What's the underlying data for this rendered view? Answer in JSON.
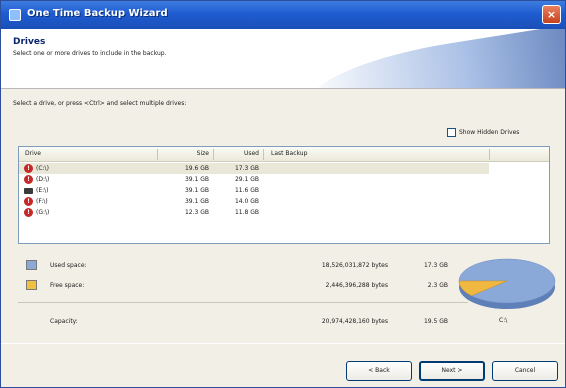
{
  "window": {
    "title": "One Time Backup Wizard",
    "close_glyph": "×"
  },
  "header": {
    "title": "Drives",
    "subtitle": "Select one or more drives to include in the backup."
  },
  "instruction": "Select a drive, or press <Ctrl> and select multiple drives:",
  "show_hidden": {
    "label": "Show Hidden Drives",
    "checked": false
  },
  "table": {
    "columns": [
      "Drive",
      "Size",
      "Used",
      "Last Backup"
    ],
    "rows": [
      {
        "drive": "(C:\\)",
        "size": "19.6 GB",
        "used": "17.3 GB",
        "last_backup": "",
        "icon": "error-drive-icon",
        "selected": true
      },
      {
        "drive": "(D:\\)",
        "size": "39.1 GB",
        "used": "29.1 GB",
        "last_backup": "",
        "icon": "error-drive-icon",
        "selected": false
      },
      {
        "drive": "(E:\\)",
        "size": "39.1 GB",
        "used": "11.6 GB",
        "last_backup": "",
        "icon": "hard-disk-icon",
        "selected": false
      },
      {
        "drive": "(F:\\)",
        "size": "39.1 GB",
        "used": "14.0 GB",
        "last_backup": "",
        "icon": "error-drive-icon",
        "selected": false
      },
      {
        "drive": "(G:\\)",
        "size": "12.3 GB",
        "used": "11.8 GB",
        "last_backup": "",
        "icon": "error-drive-icon",
        "selected": false
      }
    ]
  },
  "legend": {
    "used": {
      "label": "Used space:",
      "bytes": "18,526,031,872 bytes",
      "gb": "17.3 GB",
      "color": "#8aa8d8"
    },
    "free": {
      "label": "Free space:",
      "bytes": "2,446,396,288 bytes",
      "gb": "2.3 GB",
      "color": "#f0c040"
    },
    "capacity": {
      "label": "Capacity:",
      "bytes": "20,974,428,160 bytes",
      "gb": "19.5 GB"
    }
  },
  "pie": {
    "drive_label": "C:\\",
    "used_fraction": 0.883,
    "used_color": "#8aa8d8",
    "free_color": "#f0b840"
  },
  "buttons": {
    "back": "< Back",
    "next": "Next >",
    "cancel": "Cancel"
  }
}
